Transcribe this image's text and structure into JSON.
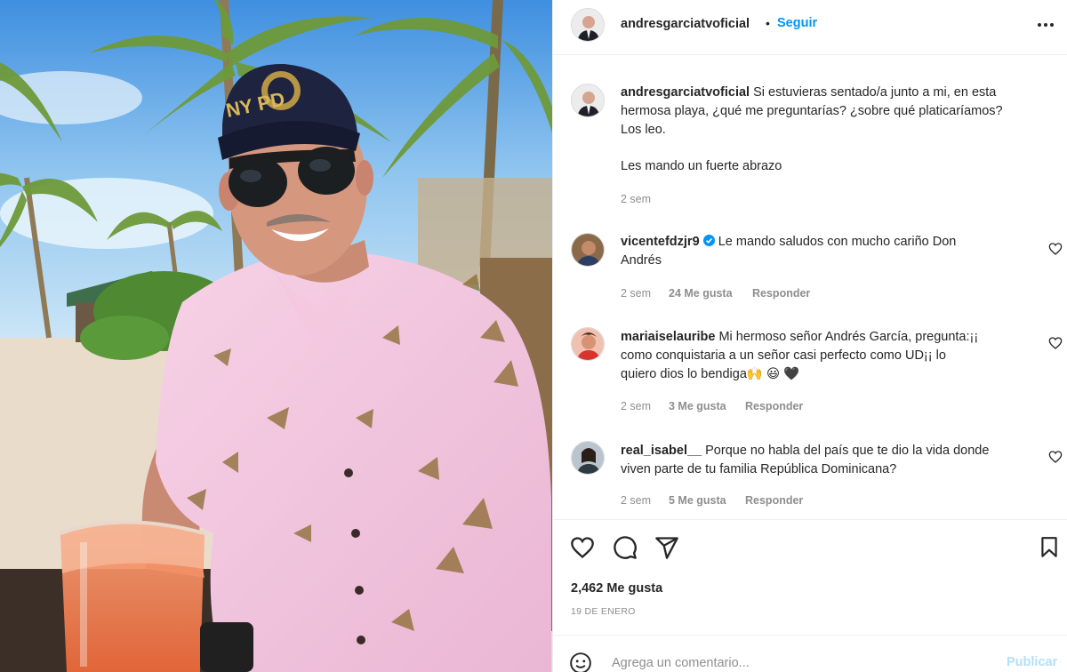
{
  "post": {
    "username": "andresgarciatvoficial",
    "dot": "•",
    "follow_label": "Seguir",
    "caption_lines": [
      "Si estuvieras sentado/a junto a mi, en esta",
      "hermosa playa, ¿qué me preguntarías? ¿sobre qué platicaríamos?",
      "Los leo."
    ],
    "caption_extra": "Les mando un fuerte abrazo",
    "caption_time": "2 sem",
    "photo_cap_text": "NY PD"
  },
  "comments": [
    {
      "username": "vicentefdzjr9",
      "verified": true,
      "lines": [
        "Le mando saludos con mucho cariño Don",
        "Andrés"
      ],
      "time": "2 sem",
      "likes": "24 Me gusta",
      "reply": "Responder"
    },
    {
      "username": "mariaiselauribe",
      "verified": false,
      "lines": [
        "Mi hermoso señor Andrés García, pregunta:¡¡",
        "como conquistaria a un señor casi perfecto como UD¡¡ lo",
        "quiero dios lo bendiga🙌 😃 🖤"
      ],
      "time": "2 sem",
      "likes": "3 Me gusta",
      "reply": "Responder"
    },
    {
      "username": "real_isabel__",
      "verified": false,
      "lines": [
        "Porque no habla del país que te dio la vida donde",
        "viven parte de tu familia República Dominicana?"
      ],
      "time": "2 sem",
      "likes": "5 Me gusta",
      "reply": "Responder"
    }
  ],
  "footer": {
    "likes": "2,462 Me gusta",
    "date": "19 DE ENERO",
    "comment_placeholder": "Agrega un comentario...",
    "publish_label": "Publicar"
  },
  "colors": {
    "link_blue": "#0095f6",
    "publish_disabled": "#b2dffc",
    "muted": "#8e8e8e",
    "text": "#262626"
  }
}
